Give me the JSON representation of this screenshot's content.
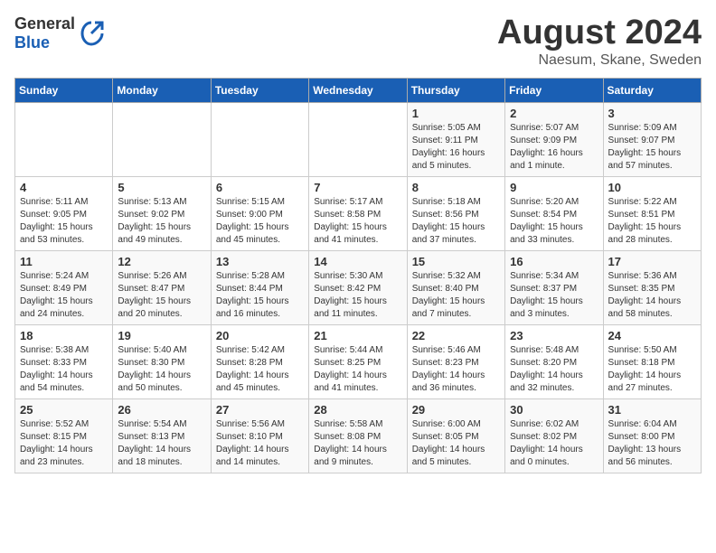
{
  "header": {
    "logo_general": "General",
    "logo_blue": "Blue",
    "title": "August 2024",
    "subtitle": "Naesum, Skane, Sweden"
  },
  "weekdays": [
    "Sunday",
    "Monday",
    "Tuesday",
    "Wednesday",
    "Thursday",
    "Friday",
    "Saturday"
  ],
  "weeks": [
    [
      {
        "day": "",
        "info": ""
      },
      {
        "day": "",
        "info": ""
      },
      {
        "day": "",
        "info": ""
      },
      {
        "day": "",
        "info": ""
      },
      {
        "day": "1",
        "info": "Sunrise: 5:05 AM\nSunset: 9:11 PM\nDaylight: 16 hours\nand 5 minutes."
      },
      {
        "day": "2",
        "info": "Sunrise: 5:07 AM\nSunset: 9:09 PM\nDaylight: 16 hours\nand 1 minute."
      },
      {
        "day": "3",
        "info": "Sunrise: 5:09 AM\nSunset: 9:07 PM\nDaylight: 15 hours\nand 57 minutes."
      }
    ],
    [
      {
        "day": "4",
        "info": "Sunrise: 5:11 AM\nSunset: 9:05 PM\nDaylight: 15 hours\nand 53 minutes."
      },
      {
        "day": "5",
        "info": "Sunrise: 5:13 AM\nSunset: 9:02 PM\nDaylight: 15 hours\nand 49 minutes."
      },
      {
        "day": "6",
        "info": "Sunrise: 5:15 AM\nSunset: 9:00 PM\nDaylight: 15 hours\nand 45 minutes."
      },
      {
        "day": "7",
        "info": "Sunrise: 5:17 AM\nSunset: 8:58 PM\nDaylight: 15 hours\nand 41 minutes."
      },
      {
        "day": "8",
        "info": "Sunrise: 5:18 AM\nSunset: 8:56 PM\nDaylight: 15 hours\nand 37 minutes."
      },
      {
        "day": "9",
        "info": "Sunrise: 5:20 AM\nSunset: 8:54 PM\nDaylight: 15 hours\nand 33 minutes."
      },
      {
        "day": "10",
        "info": "Sunrise: 5:22 AM\nSunset: 8:51 PM\nDaylight: 15 hours\nand 28 minutes."
      }
    ],
    [
      {
        "day": "11",
        "info": "Sunrise: 5:24 AM\nSunset: 8:49 PM\nDaylight: 15 hours\nand 24 minutes."
      },
      {
        "day": "12",
        "info": "Sunrise: 5:26 AM\nSunset: 8:47 PM\nDaylight: 15 hours\nand 20 minutes."
      },
      {
        "day": "13",
        "info": "Sunrise: 5:28 AM\nSunset: 8:44 PM\nDaylight: 15 hours\nand 16 minutes."
      },
      {
        "day": "14",
        "info": "Sunrise: 5:30 AM\nSunset: 8:42 PM\nDaylight: 15 hours\nand 11 minutes."
      },
      {
        "day": "15",
        "info": "Sunrise: 5:32 AM\nSunset: 8:40 PM\nDaylight: 15 hours\nand 7 minutes."
      },
      {
        "day": "16",
        "info": "Sunrise: 5:34 AM\nSunset: 8:37 PM\nDaylight: 15 hours\nand 3 minutes."
      },
      {
        "day": "17",
        "info": "Sunrise: 5:36 AM\nSunset: 8:35 PM\nDaylight: 14 hours\nand 58 minutes."
      }
    ],
    [
      {
        "day": "18",
        "info": "Sunrise: 5:38 AM\nSunset: 8:33 PM\nDaylight: 14 hours\nand 54 minutes."
      },
      {
        "day": "19",
        "info": "Sunrise: 5:40 AM\nSunset: 8:30 PM\nDaylight: 14 hours\nand 50 minutes."
      },
      {
        "day": "20",
        "info": "Sunrise: 5:42 AM\nSunset: 8:28 PM\nDaylight: 14 hours\nand 45 minutes."
      },
      {
        "day": "21",
        "info": "Sunrise: 5:44 AM\nSunset: 8:25 PM\nDaylight: 14 hours\nand 41 minutes."
      },
      {
        "day": "22",
        "info": "Sunrise: 5:46 AM\nSunset: 8:23 PM\nDaylight: 14 hours\nand 36 minutes."
      },
      {
        "day": "23",
        "info": "Sunrise: 5:48 AM\nSunset: 8:20 PM\nDaylight: 14 hours\nand 32 minutes."
      },
      {
        "day": "24",
        "info": "Sunrise: 5:50 AM\nSunset: 8:18 PM\nDaylight: 14 hours\nand 27 minutes."
      }
    ],
    [
      {
        "day": "25",
        "info": "Sunrise: 5:52 AM\nSunset: 8:15 PM\nDaylight: 14 hours\nand 23 minutes."
      },
      {
        "day": "26",
        "info": "Sunrise: 5:54 AM\nSunset: 8:13 PM\nDaylight: 14 hours\nand 18 minutes."
      },
      {
        "day": "27",
        "info": "Sunrise: 5:56 AM\nSunset: 8:10 PM\nDaylight: 14 hours\nand 14 minutes."
      },
      {
        "day": "28",
        "info": "Sunrise: 5:58 AM\nSunset: 8:08 PM\nDaylight: 14 hours\nand 9 minutes."
      },
      {
        "day": "29",
        "info": "Sunrise: 6:00 AM\nSunset: 8:05 PM\nDaylight: 14 hours\nand 5 minutes."
      },
      {
        "day": "30",
        "info": "Sunrise: 6:02 AM\nSunset: 8:02 PM\nDaylight: 14 hours\nand 0 minutes."
      },
      {
        "day": "31",
        "info": "Sunrise: 6:04 AM\nSunset: 8:00 PM\nDaylight: 13 hours\nand 56 minutes."
      }
    ]
  ]
}
